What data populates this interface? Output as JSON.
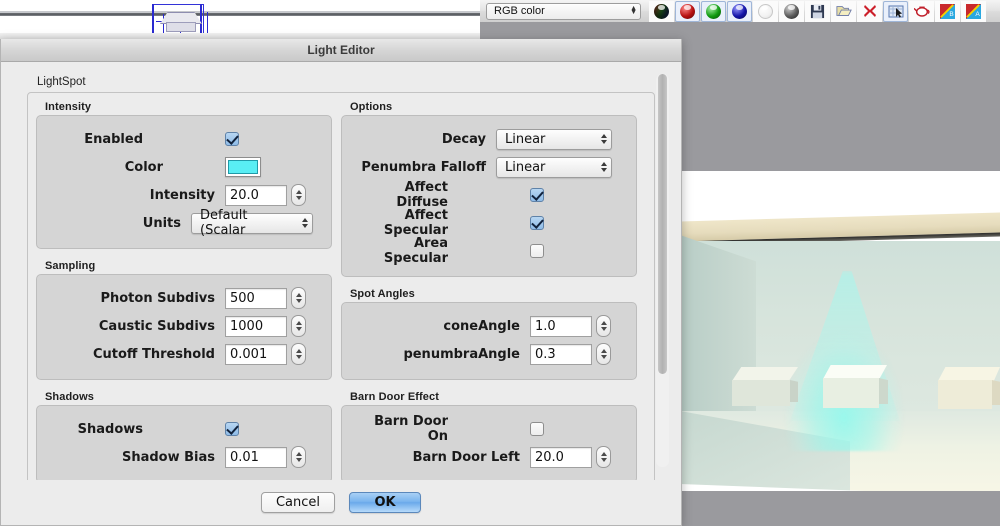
{
  "toolbar": {
    "color_mode": {
      "label": "RGB color"
    },
    "buttons": [
      {
        "name": "rgb-combined-swatch",
        "title": "RGB"
      },
      {
        "name": "red-channel-button",
        "title": "Red"
      },
      {
        "name": "green-channel-button",
        "title": "Green"
      },
      {
        "name": "blue-channel-button",
        "title": "Blue"
      },
      {
        "name": "white-channel-button",
        "title": "White"
      },
      {
        "name": "alpha-channel-button",
        "title": "Alpha"
      },
      {
        "name": "save-icon",
        "title": "Save"
      },
      {
        "name": "open-folder-icon",
        "title": "Open"
      },
      {
        "name": "delete-x-icon",
        "title": "Delete"
      },
      {
        "name": "region-select-icon",
        "title": "Region"
      },
      {
        "name": "teapot-icon",
        "title": "Teapot"
      },
      {
        "name": "channel-b-icon",
        "title": "Channel B"
      },
      {
        "name": "channel-a-icon",
        "title": "Channel A"
      }
    ]
  },
  "dialog": {
    "title": "Light Editor",
    "object_name": "LightSpot",
    "groups_left": [
      {
        "title": "Intensity",
        "rows": [
          {
            "label": "Enabled",
            "type": "checkbox",
            "value": true
          },
          {
            "label": "Color",
            "type": "swatch",
            "value": "#59eef4"
          },
          {
            "label": "Intensity",
            "type": "number",
            "value": "20.0"
          },
          {
            "label": "Units",
            "type": "popup",
            "value": "Default (Scalar"
          }
        ]
      },
      {
        "title": "Sampling",
        "rows": [
          {
            "label": "Photon Subdivs",
            "type": "number",
            "value": "500"
          },
          {
            "label": "Caustic Subdivs",
            "type": "number",
            "value": "1000"
          },
          {
            "label": "Cutoff Threshold",
            "type": "number",
            "value": "0.001"
          }
        ]
      },
      {
        "title": "Shadows",
        "rows": [
          {
            "label": "Shadows",
            "type": "checkbox",
            "value": true
          },
          {
            "label": "Shadow Bias",
            "type": "number",
            "value": "0.01"
          }
        ]
      }
    ],
    "groups_right": [
      {
        "title": "Options",
        "rows": [
          {
            "label": "Decay",
            "type": "popup",
            "value": "Linear"
          },
          {
            "label": "Penumbra Falloff",
            "type": "popup",
            "value": "Linear"
          },
          {
            "label": "Affect Diffuse",
            "type": "checkbox",
            "value": true
          },
          {
            "label": "Affect Specular",
            "type": "checkbox",
            "value": true
          },
          {
            "label": "Area Specular",
            "type": "checkbox",
            "value": false
          }
        ]
      },
      {
        "title": "Spot Angles",
        "rows": [
          {
            "label": "coneAngle",
            "type": "number",
            "value": "1.0"
          },
          {
            "label": "penumbraAngle",
            "type": "number",
            "value": "0.3"
          }
        ]
      },
      {
        "title": "Barn Door Effect",
        "rows": [
          {
            "label": "Barn Door On",
            "type": "checkbox",
            "value": false
          },
          {
            "label": "Barn Door Left",
            "type": "number",
            "value": "20.0"
          }
        ]
      }
    ],
    "footer": {
      "cancel_label": "Cancel",
      "ok_label": "OK"
    }
  },
  "colors": {
    "accent_blue": "#7ab4ee",
    "light_color": "#59eef4",
    "dialog_bg": "#ececec",
    "group_bg": "#d5d5d5",
    "desktop": "#9a9a9e"
  }
}
